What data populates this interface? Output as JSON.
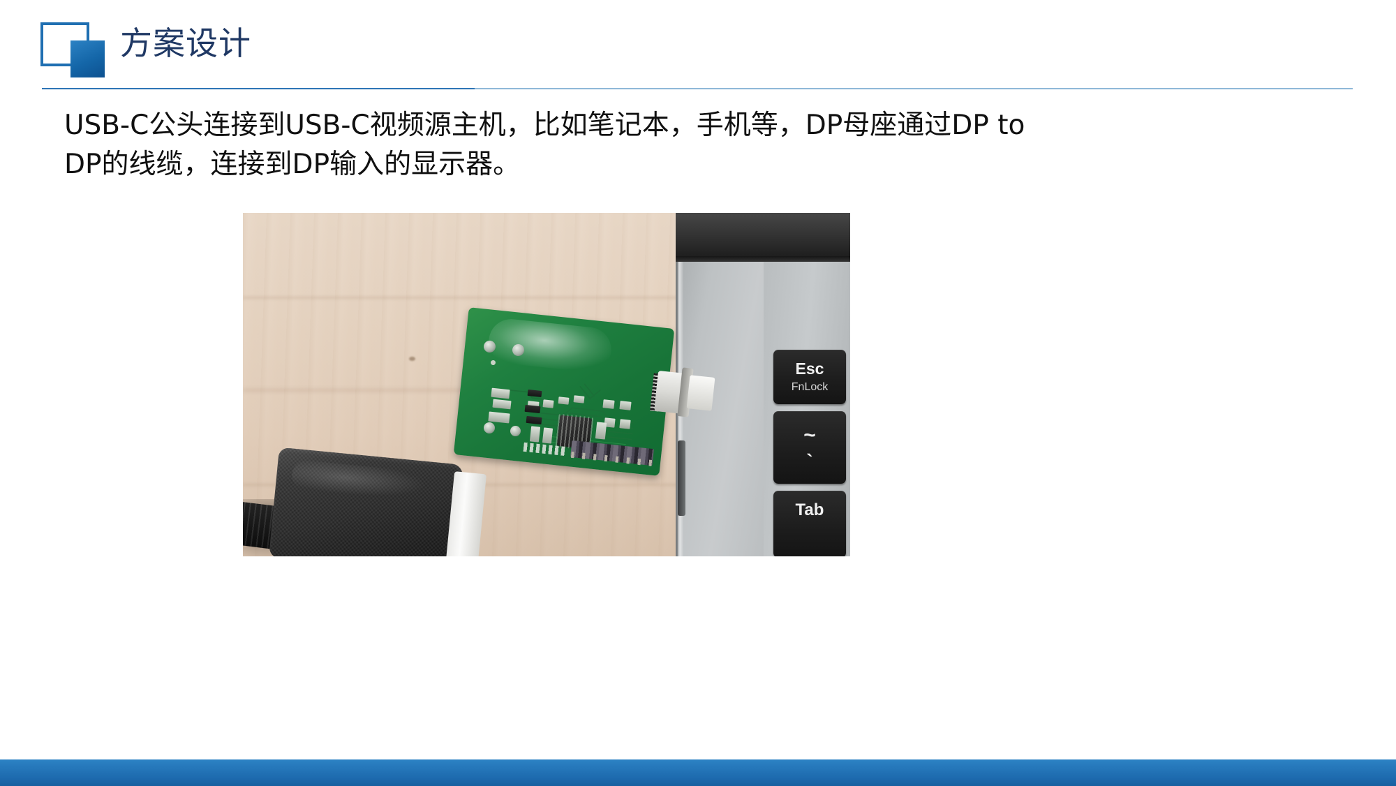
{
  "slide": {
    "title": "方案设计",
    "logo_icon": "square-outline-with-filled-square-icon",
    "accent_color": "#1F6FB2",
    "title_color": "#1F3864",
    "rule_left_color": "#2E75B6",
    "rule_right_color": "#8FB8D8",
    "bottom_band_color": "#1F6FB2"
  },
  "body": {
    "line1": "USB-C公头连接到USB-C视频源主机，比如笔记本，手机等，DP母座通过DP  to",
    "line2": "DP的线缆，连接到DP输入的显示器。"
  },
  "photo": {
    "caption": "",
    "scene": "USB-C to DisplayPort adapter board connected to a laptop on a wooden desk",
    "laptop": {
      "keys": [
        {
          "main": "Esc",
          "sub": "FnLock"
        },
        {
          "main": "~",
          "sub": "`"
        },
        {
          "main": "Tab",
          "sub": ""
        }
      ]
    }
  }
}
